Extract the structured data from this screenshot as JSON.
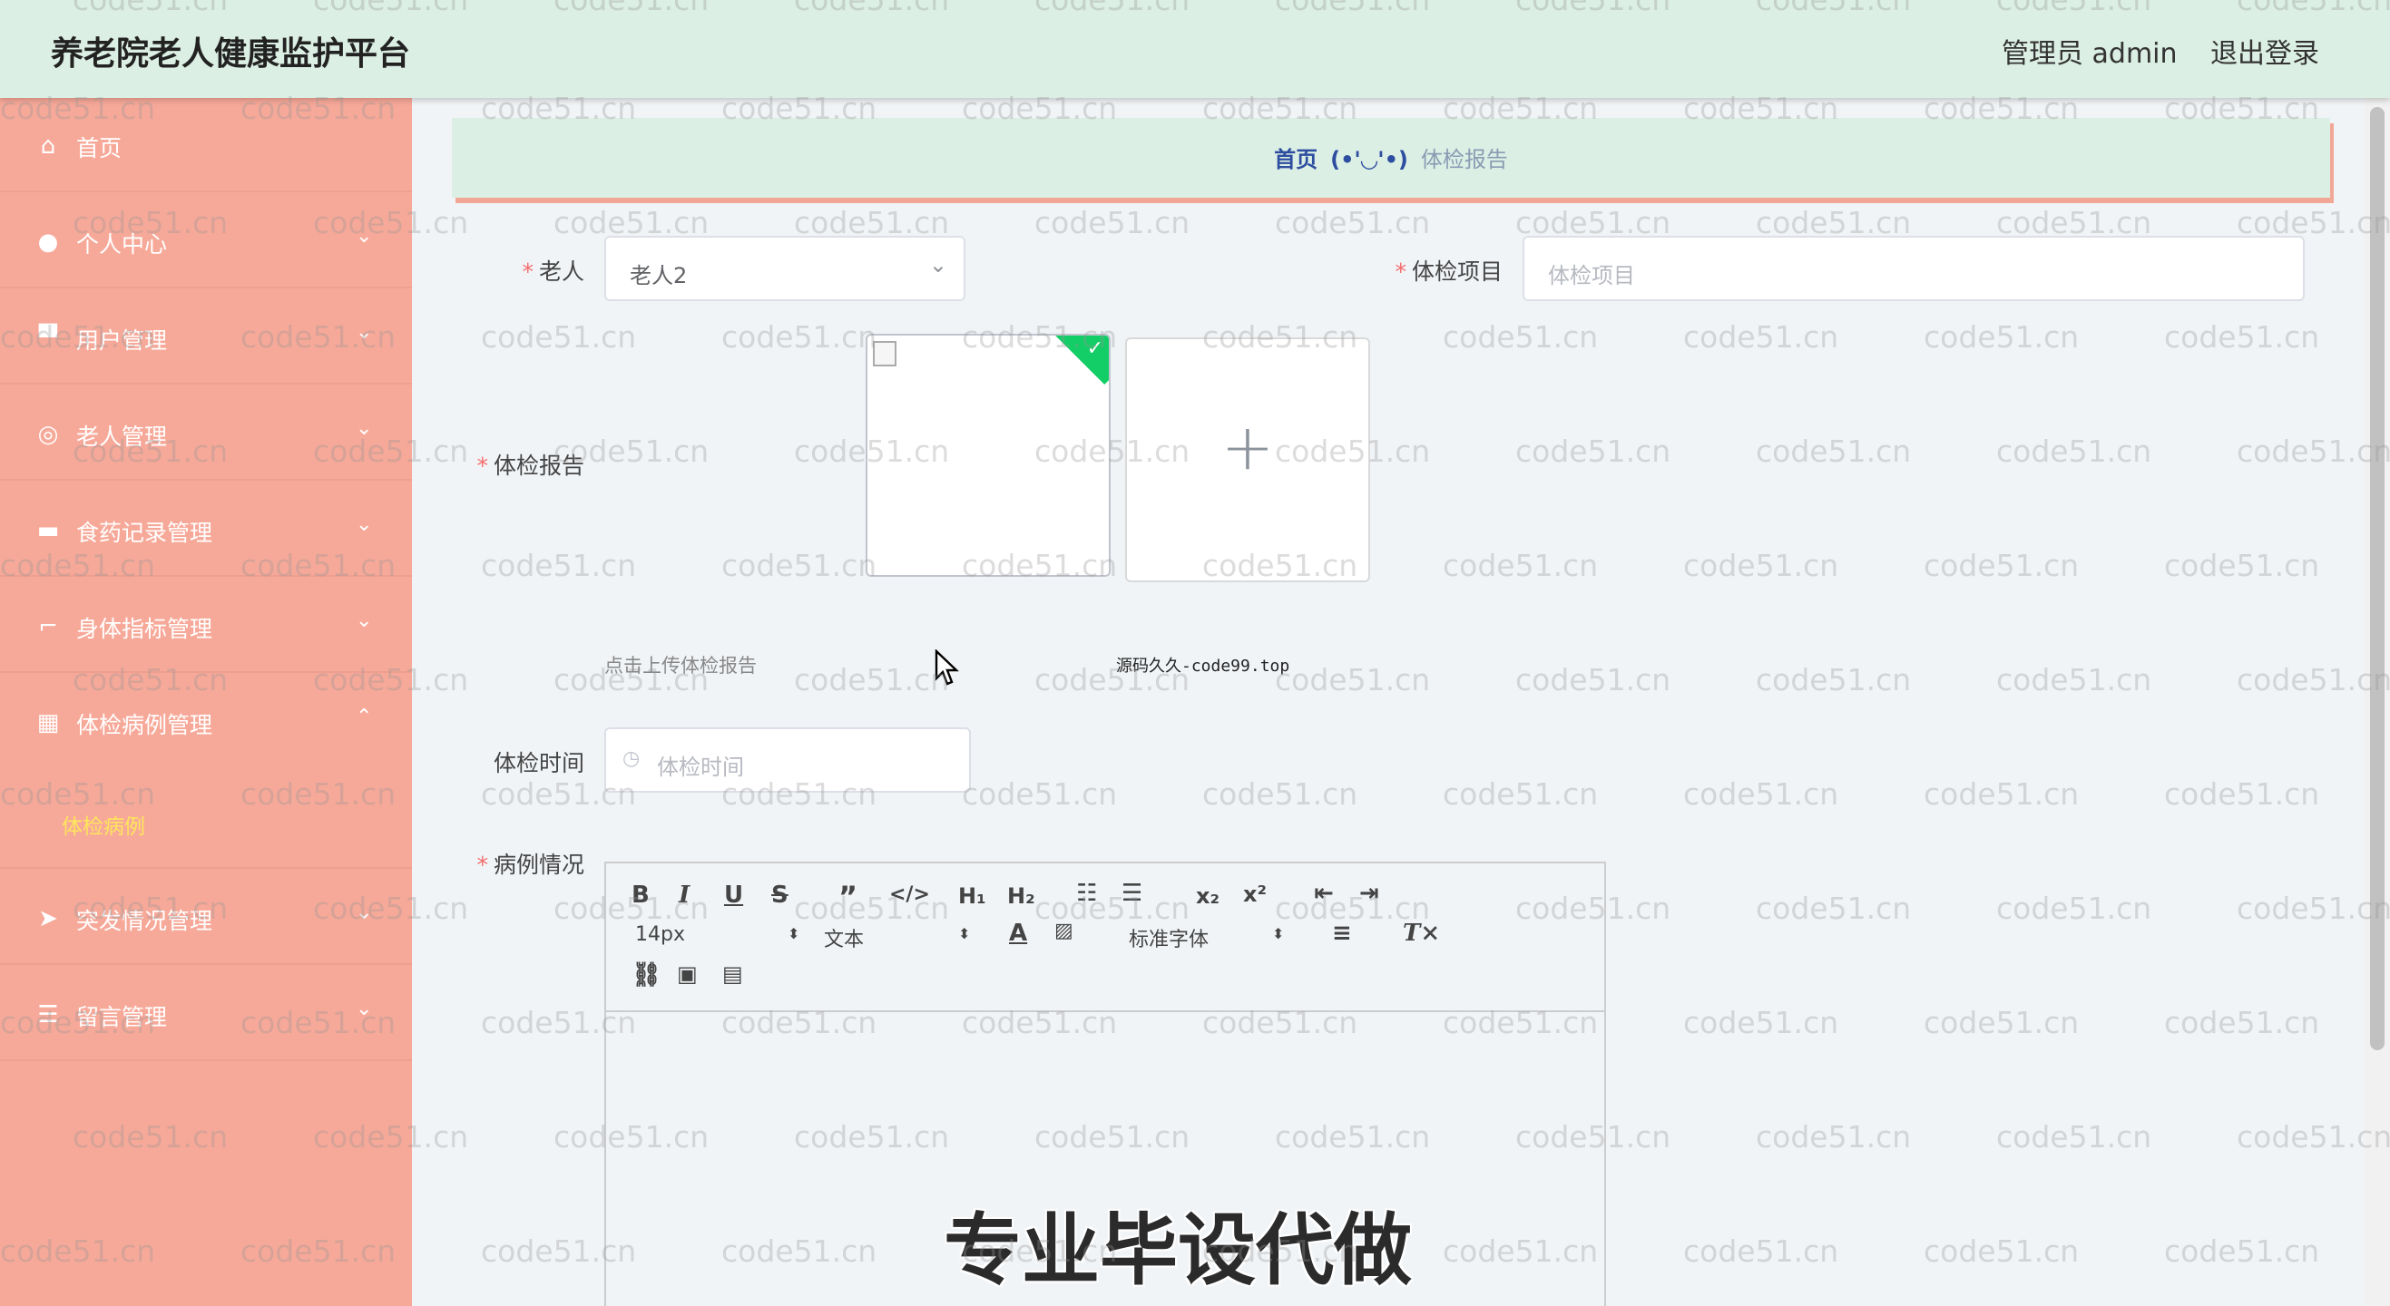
{
  "header": {
    "title": "养老院老人健康监护平台",
    "admin": "管理员 admin",
    "logout": "退出登录"
  },
  "sidebar": {
    "items": [
      {
        "label": "首页",
        "icon": "home-icon"
      },
      {
        "label": "个人中心",
        "icon": "user-icon"
      },
      {
        "label": "用户管理",
        "icon": "users-icon"
      },
      {
        "label": "老人管理",
        "icon": "elder-icon"
      },
      {
        "label": "食药记录管理",
        "icon": "monitor-icon"
      },
      {
        "label": "身体指标管理",
        "icon": "crop-icon"
      },
      {
        "label": "体检病例管理",
        "icon": "grid-icon"
      },
      {
        "label": "突发情况管理",
        "icon": "send-icon"
      },
      {
        "label": "留言管理",
        "icon": "list-icon"
      }
    ],
    "sub_item": "体检病例"
  },
  "breadcrumb": {
    "home": "首页",
    "emoticon": "(•'◡'•)",
    "current": "体检报告"
  },
  "form": {
    "elder_label": "老人",
    "elder_value": "老人2",
    "project_label": "体检项目",
    "project_placeholder": "体检项目",
    "report_label": "体检报告",
    "upload_tip": "点击上传体检报告",
    "source_tag": "源码久久-code99.top",
    "time_label": "体检时间",
    "time_placeholder": "体检时间",
    "case_label": "病例情况"
  },
  "editor": {
    "font_size": "14px",
    "header_select": "文本",
    "font_family": "标准字体"
  },
  "promo": "专业毕设代做",
  "watermark": "code51.cn"
}
